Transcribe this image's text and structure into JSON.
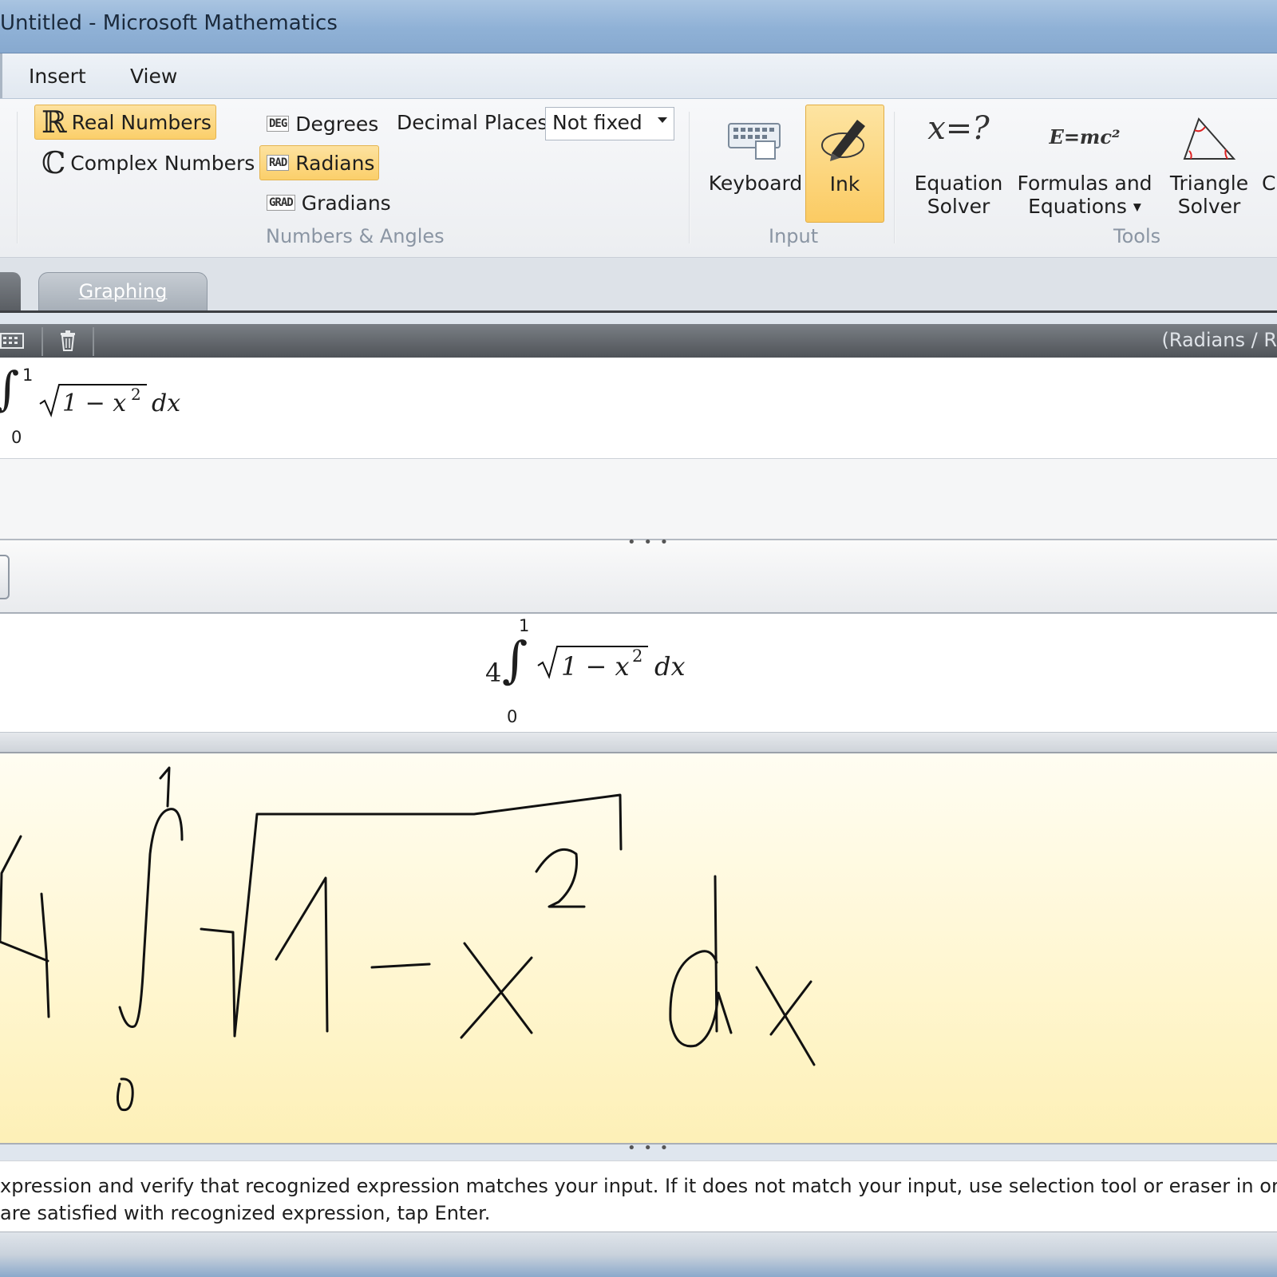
{
  "window": {
    "title": "Untitled - Microsoft Mathematics"
  },
  "menu": {
    "tabs": [
      "Insert",
      "View"
    ]
  },
  "ribbon": {
    "numbers": {
      "real": "Real Numbers",
      "complex": "Complex Numbers"
    },
    "angles": {
      "degrees": "Degrees",
      "radians": "Radians",
      "gradians": "Gradians",
      "deg_tag": "DEG",
      "rad_tag": "RAD",
      "grad_tag": "GRAD"
    },
    "decimal_places": {
      "label": "Decimal Places",
      "value": "Not fixed"
    },
    "group_numbers_angles": "Numbers & Angles",
    "input": {
      "keyboard": "Keyboard",
      "ink": "Ink",
      "group": "Input"
    },
    "tools": {
      "equation_solver": [
        "Equation",
        "Solver"
      ],
      "formulas": [
        "Formulas and",
        "Equations"
      ],
      "triangle_solver": [
        "Triangle",
        "Solver"
      ],
      "partial_next": "C",
      "group": "Tools",
      "equation_icon_text": "x=?",
      "formulas_icon_text": "E=mc²"
    }
  },
  "tabs": {
    "graphing": "Graphing"
  },
  "worksheet_toolbar": {
    "status": "(Radians / R"
  },
  "worksheet_input": {
    "upper": "1",
    "lower": "0",
    "radicand": "1 − x",
    "exponent": "2",
    "differential": "dx"
  },
  "recognized": {
    "coefficient": "4",
    "upper": "1",
    "lower": "0",
    "radicand": "1 − x",
    "exponent": "2",
    "differential": "dx"
  },
  "message": {
    "line1": "xpression and verify that recognized expression matches your input. If it does not match your input, use selection tool or eraser in order",
    "line2": " are satisfied with recognized expression, tap Enter."
  },
  "colors": {
    "accent_selected": "#fbcf6a",
    "inkpad": "#fff6cf",
    "title_bar": "#8fb1d6"
  }
}
